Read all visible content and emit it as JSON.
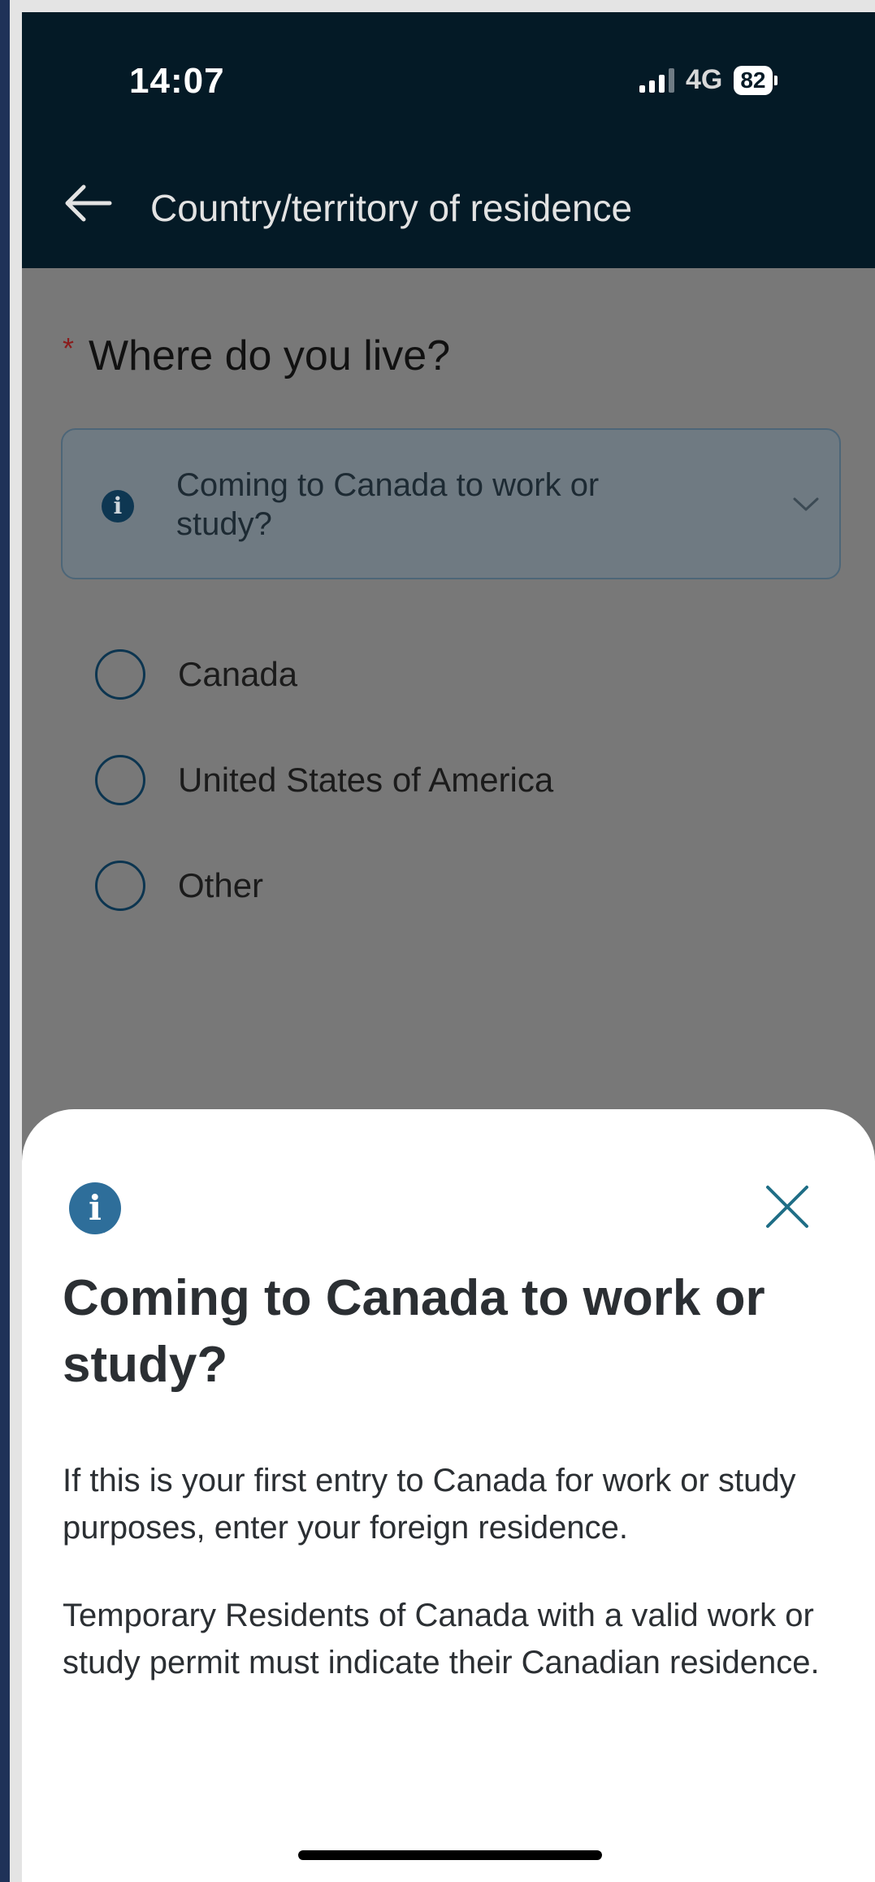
{
  "status_bar": {
    "time": "14:07",
    "network": "4G",
    "battery": "82"
  },
  "header": {
    "title": "Country/territory of residence"
  },
  "form": {
    "required_mark": "*",
    "question": "Where do you live?",
    "info_box": {
      "text": "Coming to Canada to work or study?"
    },
    "options": [
      "Canada",
      "United States of America",
      "Other"
    ]
  },
  "sheet": {
    "heading": "Coming to Canada to work or study?",
    "paragraph1": "If this is your first entry to Canada for work or study purposes, enter your foreign residence.",
    "paragraph2": "Temporary Residents of Canada with a valid work or study permit must indicate their Canadian residence."
  },
  "icons": {
    "back": "arrow-left-icon",
    "info": "info-icon",
    "chevron": "chevron-down-icon",
    "close": "close-icon"
  },
  "colors": {
    "header_bg": "#041a26",
    "accent_blue": "#2e6e9a",
    "close_teal": "#1f6e86",
    "required_red": "#8a1c1c"
  }
}
